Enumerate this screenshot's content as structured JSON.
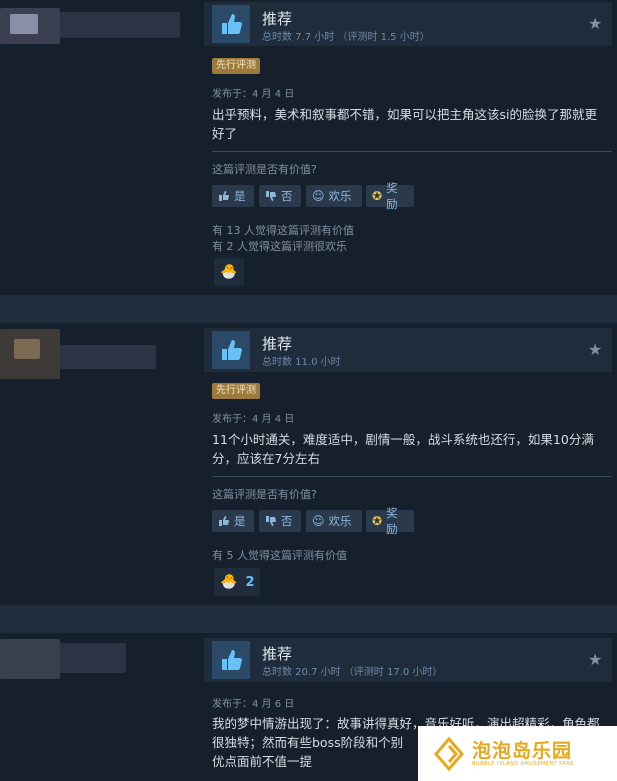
{
  "reviews": [
    {
      "verdict": "推荐",
      "hours": "总时数 7.7 小时  （评测时 1.5 小时）",
      "early_access": "先行评测",
      "posted": "发布于：4 月 4 日",
      "body": "出乎预料，美术和叙事都不错，如果可以把主角这该si的脸换了那就更好了",
      "helpful_q": "这篇评测是否有价值?",
      "buttons": {
        "yes": "是",
        "no": "否",
        "funny": "欢乐",
        "award": "奖励"
      },
      "stats": [
        "有 13 人觉得这篇评测有价值",
        "有 2 人觉得这篇评测很欢乐"
      ],
      "award_count": ""
    },
    {
      "verdict": "推荐",
      "hours": "总时数 11.0 小时",
      "early_access": "先行评测",
      "posted": "发布于：4 月 4 日",
      "body": "11个小时通关，难度适中，剧情一般，战斗系统也还行，如果10分满分，应该在7分左右",
      "helpful_q": "这篇评测是否有价值?",
      "buttons": {
        "yes": "是",
        "no": "否",
        "funny": "欢乐",
        "award": "奖励"
      },
      "stats": [
        "有 5 人觉得这篇评测有价值"
      ],
      "award_count": "2"
    },
    {
      "verdict": "推荐",
      "hours": "总时数 20.7 小时  （评测时 17.0 小时）",
      "posted": "发布于：4 月 6 日",
      "body": "我的梦中情游出现了：故事讲得真好，音乐好听，演出超精彩，角色都很独特；然而有些boss阶段和个别",
      "body2": "优点面前不值一提"
    }
  ],
  "watermark": {
    "title": "泡泡岛乐园",
    "subtitle": "BUBBLE ISLAND AMUSEMENT PARK"
  },
  "colors": {
    "accent": "#66c0f4",
    "background": "#1b2838",
    "early_access": "#9c7a3c"
  }
}
